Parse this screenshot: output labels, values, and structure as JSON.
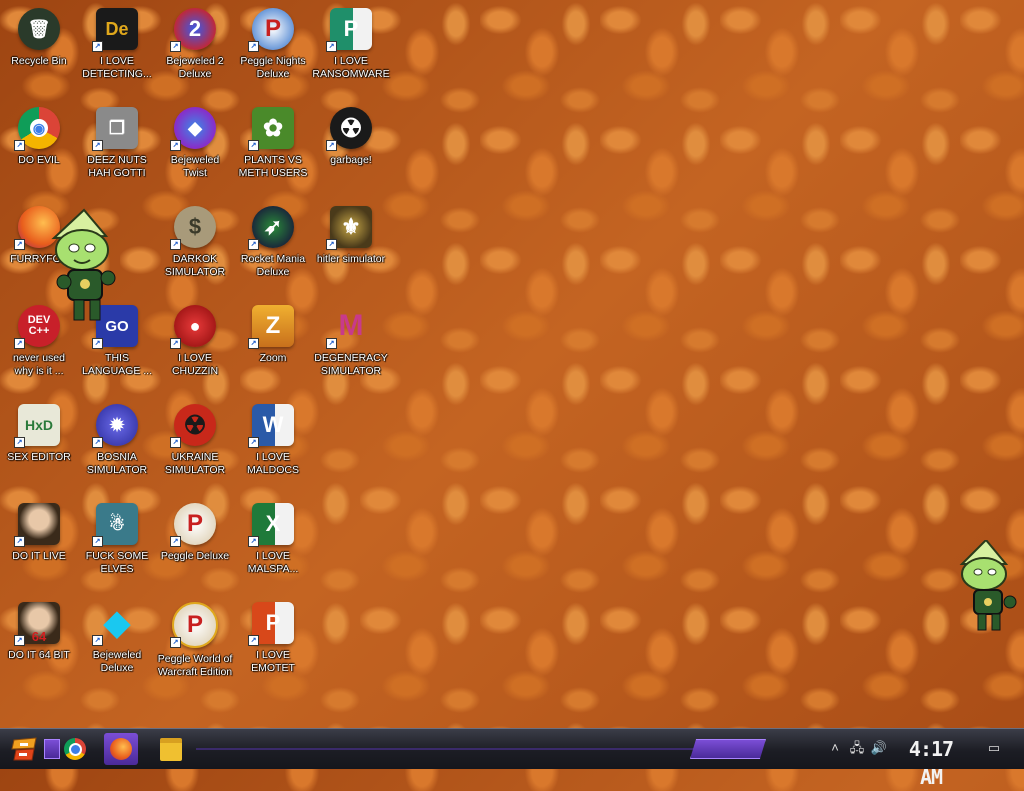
{
  "desktop": {
    "icons": [
      {
        "label": "Recycle Bin",
        "glyph": "🗑",
        "bg": "#2a3a2a"
      },
      {
        "label": "I LOVE\nDETECTING...",
        "glyph": "De",
        "bg": "#e0a81c"
      },
      {
        "label": "Bejeweled 2\nDeluxe",
        "glyph": "2",
        "bg": "#c0283a"
      },
      {
        "label": "Peggle Nights\nDeluxe",
        "glyph": "P",
        "bg": "#2a6cc8"
      },
      {
        "label": "I LOVE\nRANSOMWARE",
        "glyph": "P",
        "bg": "#1f8f6a"
      },
      {
        "label": "DO EVIL",
        "glyph": "◉",
        "bg": "#3d7ee6"
      },
      {
        "label": "DEEZ NUTS\nHAH GOTTI",
        "glyph": "❐",
        "bg": "#7d7d7d"
      },
      {
        "label": "Bejeweled\nTwist",
        "glyph": "◆",
        "bg": "#8a2bc8"
      },
      {
        "label": "PLANTS VS\nMETH USERS",
        "glyph": "✿",
        "bg": "#4a8a2a"
      },
      {
        "label": "garbage!",
        "glyph": "☢",
        "bg": "#1a1a1a"
      },
      {
        "label": "FURRYFOX",
        "glyph": "🦊",
        "bg": "#e85d1c"
      },
      {
        "label": "DARKOK\nSIMULATOR",
        "glyph": "$",
        "bg": "#8a7a5a"
      },
      {
        "label": "Rocket Mania\nDeluxe",
        "glyph": "➶",
        "bg": "#1a2a3a"
      },
      {
        "label": "hitler simulator",
        "glyph": "⚜",
        "bg": "#6a5a2a"
      },
      {
        "label": "never used\nwhy is it ...",
        "glyph": "DEV\nC++",
        "bg": "#c8202a"
      },
      {
        "label": "THIS\nLANGUAGE ...",
        "glyph": "GO",
        "bg": "#2a3aa8"
      },
      {
        "label": "I LOVE\nCHUZZIN",
        "glyph": "●",
        "bg": "#c01a1a"
      },
      {
        "label": "Zoom",
        "glyph": "Z",
        "bg": "#e09a1c"
      },
      {
        "label": "DEGENERACY\nSIMULATOR",
        "glyph": "M",
        "bg": "#c83a8a"
      },
      {
        "label": "SEX EDITOR",
        "glyph": "HxD",
        "bg": "#e8e8d8"
      },
      {
        "label": "BOSNIA\nSIMULATOR",
        "glyph": "✹",
        "bg": "#3a3ac8"
      },
      {
        "label": "UKRAINE\nSIMULATOR",
        "glyph": "☢",
        "bg": "#c8281a"
      },
      {
        "label": "I LOVE\nMALDOCS",
        "glyph": "W",
        "bg": "#2a5aa8"
      },
      {
        "label": "DO IT LIVE",
        "glyph": "♛",
        "bg": "#5a3a2a"
      },
      {
        "label": "FUCK SOME\nELVES",
        "glyph": "☃",
        "bg": "#3a7a8a"
      },
      {
        "label": "Peggle Deluxe",
        "glyph": "P",
        "bg": "#d8c8a8"
      },
      {
        "label": "I LOVE\nMALSPA...",
        "glyph": "X",
        "bg": "#1f7a3a"
      },
      {
        "label": "DO IT 64 BIT",
        "glyph": "64",
        "bg": "#5a3a2a"
      },
      {
        "label": "Bejeweled\nDeluxe",
        "glyph": "◆",
        "bg": "#1aa8d8"
      },
      {
        "label": "Peggle World of\nWarcraft Edition",
        "glyph": "P",
        "bg": "#d8c8a8"
      },
      {
        "label": "I LOVE EMOTET",
        "glyph": "P",
        "bg": "#d8481a"
      }
    ]
  },
  "taskbar": {
    "clock": "4:17 AM",
    "pinned": [
      {
        "name": "chrome",
        "glyph": "◉",
        "color": "#3d7ee6"
      },
      {
        "name": "firefox",
        "glyph": "●",
        "color": "#e85d1c"
      },
      {
        "name": "file-explorer",
        "glyph": "▣",
        "color": "#f0c030"
      }
    ]
  }
}
